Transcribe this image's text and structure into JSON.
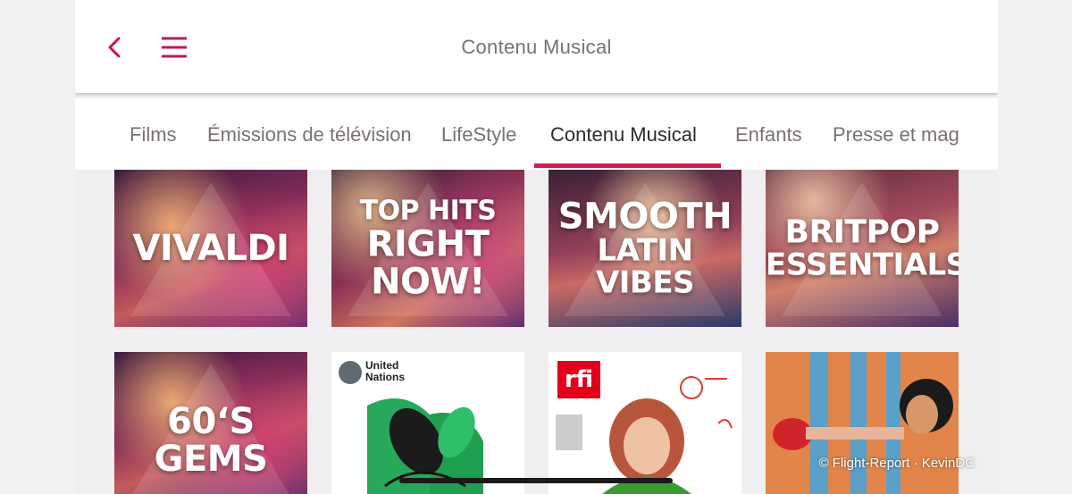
{
  "header": {
    "title": "Contenu Musical",
    "back_icon": "chevron-left-icon",
    "menu_icon": "hamburger-menu-icon",
    "accent_color": "#d81b55"
  },
  "tabs": [
    {
      "label": "Films",
      "active": false
    },
    {
      "label": "Émissions de télévision",
      "active": false
    },
    {
      "label": "LifeStyle",
      "active": false
    },
    {
      "label": "Contenu Musical",
      "active": true
    },
    {
      "label": "Enfants",
      "active": false
    },
    {
      "label": "Presse et mag",
      "active": false
    }
  ],
  "tiles": [
    {
      "lines": [
        "Vivaldi"
      ]
    },
    {
      "lines": [
        "Top Hits",
        "Right Now!"
      ]
    },
    {
      "lines": [
        "Smooth",
        "Latin Vibes"
      ]
    },
    {
      "lines": [
        "Britpop",
        "Essentials"
      ]
    },
    {
      "lines": [
        "60‘s",
        "Gems"
      ]
    },
    {
      "brand_line1": "United",
      "brand_line2": "Nations"
    },
    {
      "brand": "rfi"
    },
    {
      "illustration": "boxing-glove"
    }
  ],
  "watermark": "© Flight-Report · KevinDC"
}
